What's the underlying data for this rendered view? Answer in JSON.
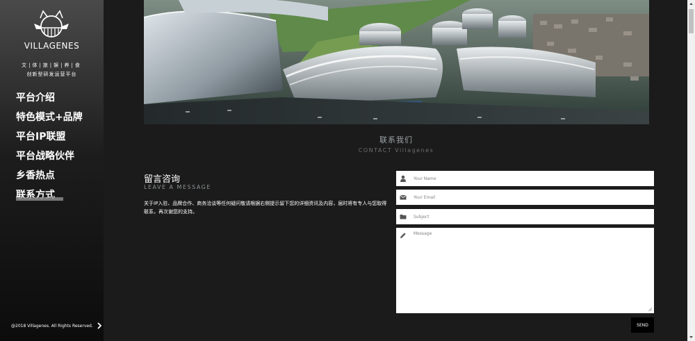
{
  "sidebar": {
    "brand": "VILLAGENES",
    "tagline_top": "文|体|旅|娱|养|食",
    "tagline_bottom": "创新型研发运营平台",
    "nav": [
      {
        "label": "平台介绍"
      },
      {
        "label": "特色模式+品牌"
      },
      {
        "label": "平台IP联盟"
      },
      {
        "label": "平台战略伙伴"
      },
      {
        "label": "乡香热点"
      },
      {
        "label": "联系方式",
        "active": true
      }
    ],
    "copyright": "@2018 Villagenes. All Rights Reserved."
  },
  "section": {
    "title": "联系我们",
    "subtitle": "CONTACT Villagenes"
  },
  "message": {
    "title": "留言咨询",
    "subtitle": "LEAVE A MESSAGE",
    "body": "关于IP入驻、品牌合作、商务洽谈等任何疑问敬请根据右侧提示留下您的详细资讯及内容，届时将有专人与您取得联系，再次谢您的支持。"
  },
  "form": {
    "name_placeholder": "Your Name",
    "email_placeholder": "Your Email",
    "subject_placeholder": "Subject",
    "message_placeholder": "Message",
    "send_label": "SEND"
  },
  "icons": {
    "name": "user-icon",
    "email": "envelope-icon",
    "subject": "folder-icon",
    "message": "pencil-icon"
  }
}
